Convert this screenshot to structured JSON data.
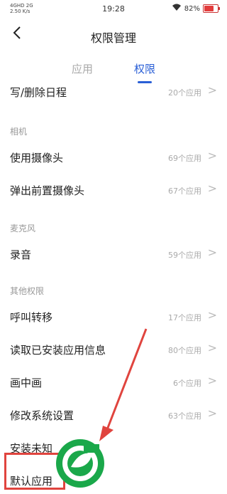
{
  "status_bar": {
    "signal_left": "4GHD 2G",
    "speed": "2.50 K/s",
    "time": "19:28",
    "battery_percent": "82%",
    "battery_level": 0.82
  },
  "header": {
    "title": "权限管理"
  },
  "tabs": {
    "apps": "应用",
    "permissions": "权限"
  },
  "sections": {
    "camera": "相机",
    "microphone": "麦克风",
    "other": "其他权限"
  },
  "rows": [
    {
      "label": "写/删除日程",
      "count": "20个应用"
    },
    {
      "label": "使用摄像头",
      "count": "69个应用"
    },
    {
      "label": "弹出前置摄像头",
      "count": "67个应用"
    },
    {
      "label": "录音",
      "count": "59个应用"
    },
    {
      "label": "呼叫转移",
      "count": "17个应用"
    },
    {
      "label": "读取已安装应用信息",
      "count": "80个应用"
    },
    {
      "label": "画中画",
      "count": "6个应用"
    },
    {
      "label": "修改系统设置",
      "count": "63个应用"
    },
    {
      "label": "安装未知",
      "count": ""
    },
    {
      "label": "默认应用",
      "count": ""
    }
  ],
  "colors": {
    "accent": "#2a5fd6",
    "annotation_red": "#e0443e",
    "logo_green": "#1aa84a"
  }
}
